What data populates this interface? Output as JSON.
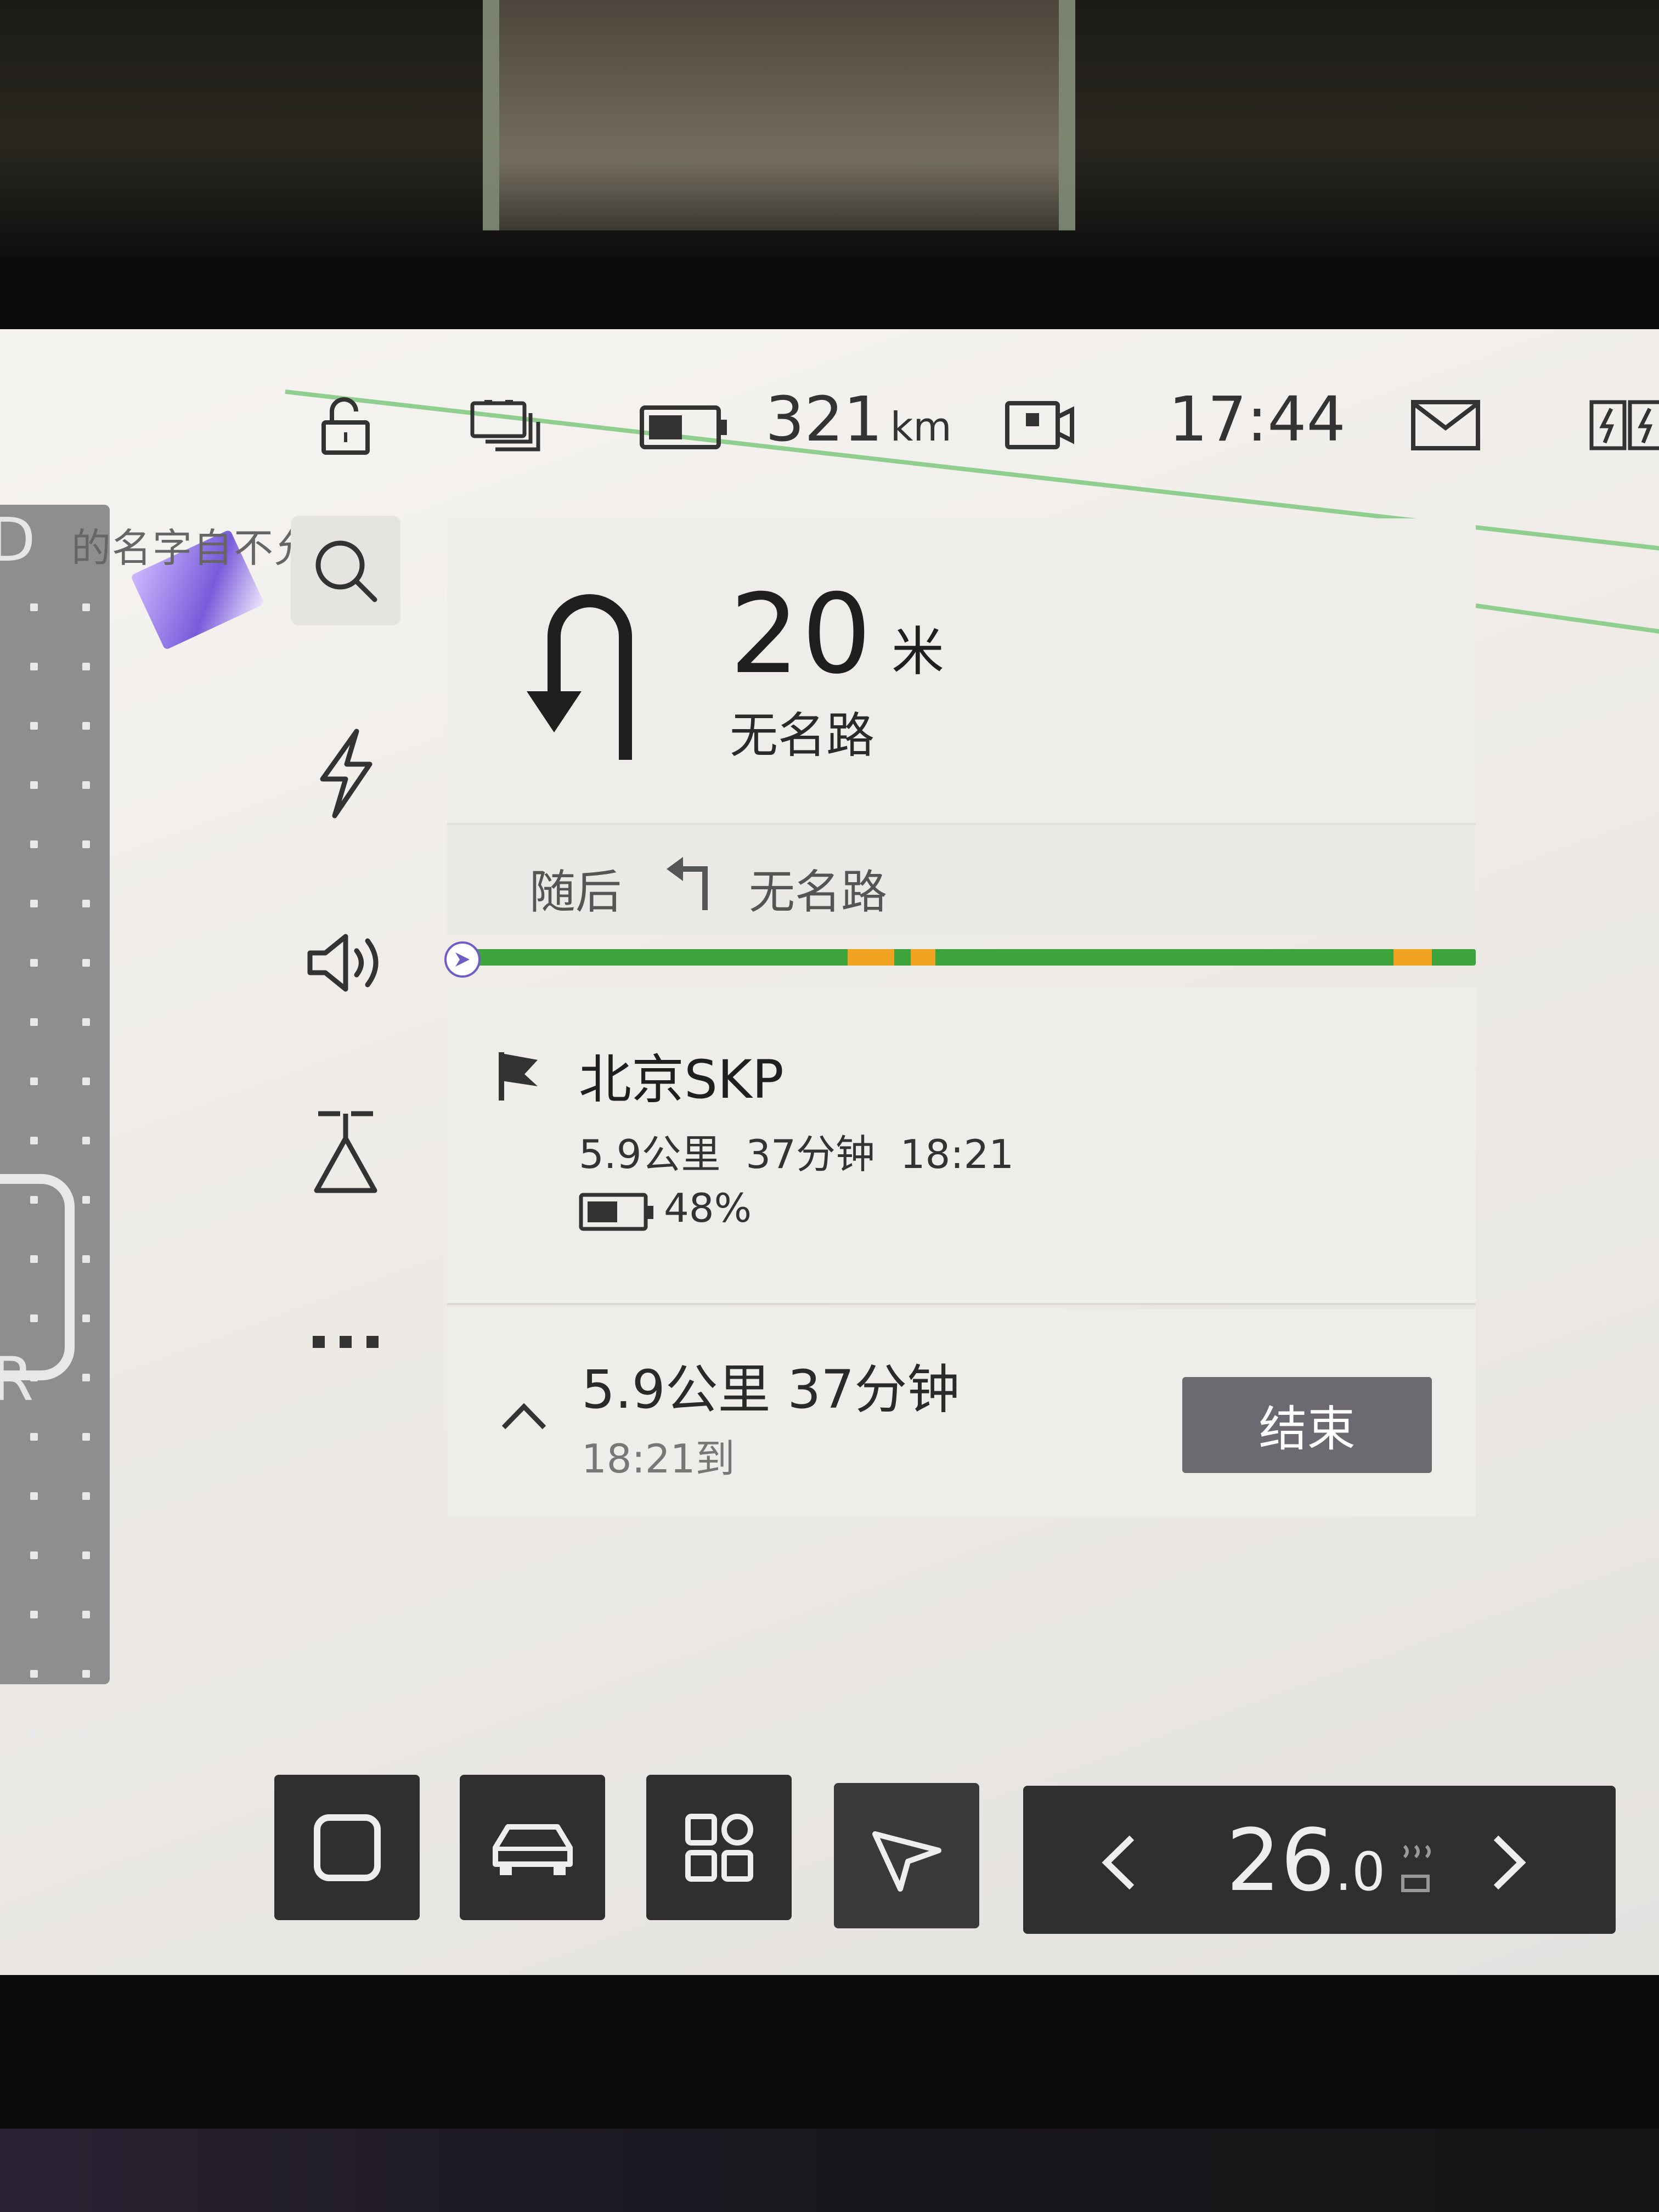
{
  "status_bar": {
    "range_value": "321",
    "range_unit": "km",
    "clock": "17:44",
    "icons": [
      "unlock-icon",
      "battery-pack-icon",
      "battery-icon",
      "dashcam-icon",
      "mail-icon",
      "charging-icon"
    ]
  },
  "toast": {
    "text": "的名字自不允不"
  },
  "side_tools": [
    "search-icon",
    "lightning-icon",
    "volume-icon",
    "route-preference-icon",
    "more-icon"
  ],
  "guidance": {
    "distance": "20",
    "distance_unit": "米",
    "road": "无名路",
    "next_label": "随后",
    "next_road": "无名路",
    "maneuver_icon": "u-turn-icon",
    "next_maneuver_icon": "turn-left-icon"
  },
  "route_progress": {
    "traffic_colors": {
      "smooth": "#3da33d",
      "slow": "#f0a321"
    }
  },
  "destination": {
    "name": "北京SKP",
    "distance": "5.9公里",
    "duration": "37分钟",
    "arrival": "18:21",
    "battery": "48%"
  },
  "summary": {
    "distance": "5.9公里",
    "duration": "37分钟",
    "eta": "18:21到",
    "end_button": "结束"
  },
  "dock": {
    "buttons": [
      "home-square-icon",
      "car-icon",
      "apps-grid-icon",
      "navigation-icon"
    ],
    "temperature_int": "26",
    "temperature_dec": ".0"
  },
  "colors": {
    "screen_bg": "#f2efeb",
    "card_bg": "#efede9",
    "dock_bg": "#2f2f2f",
    "end_button_bg": "#6c6a70",
    "map_road": "#8fce8f"
  }
}
